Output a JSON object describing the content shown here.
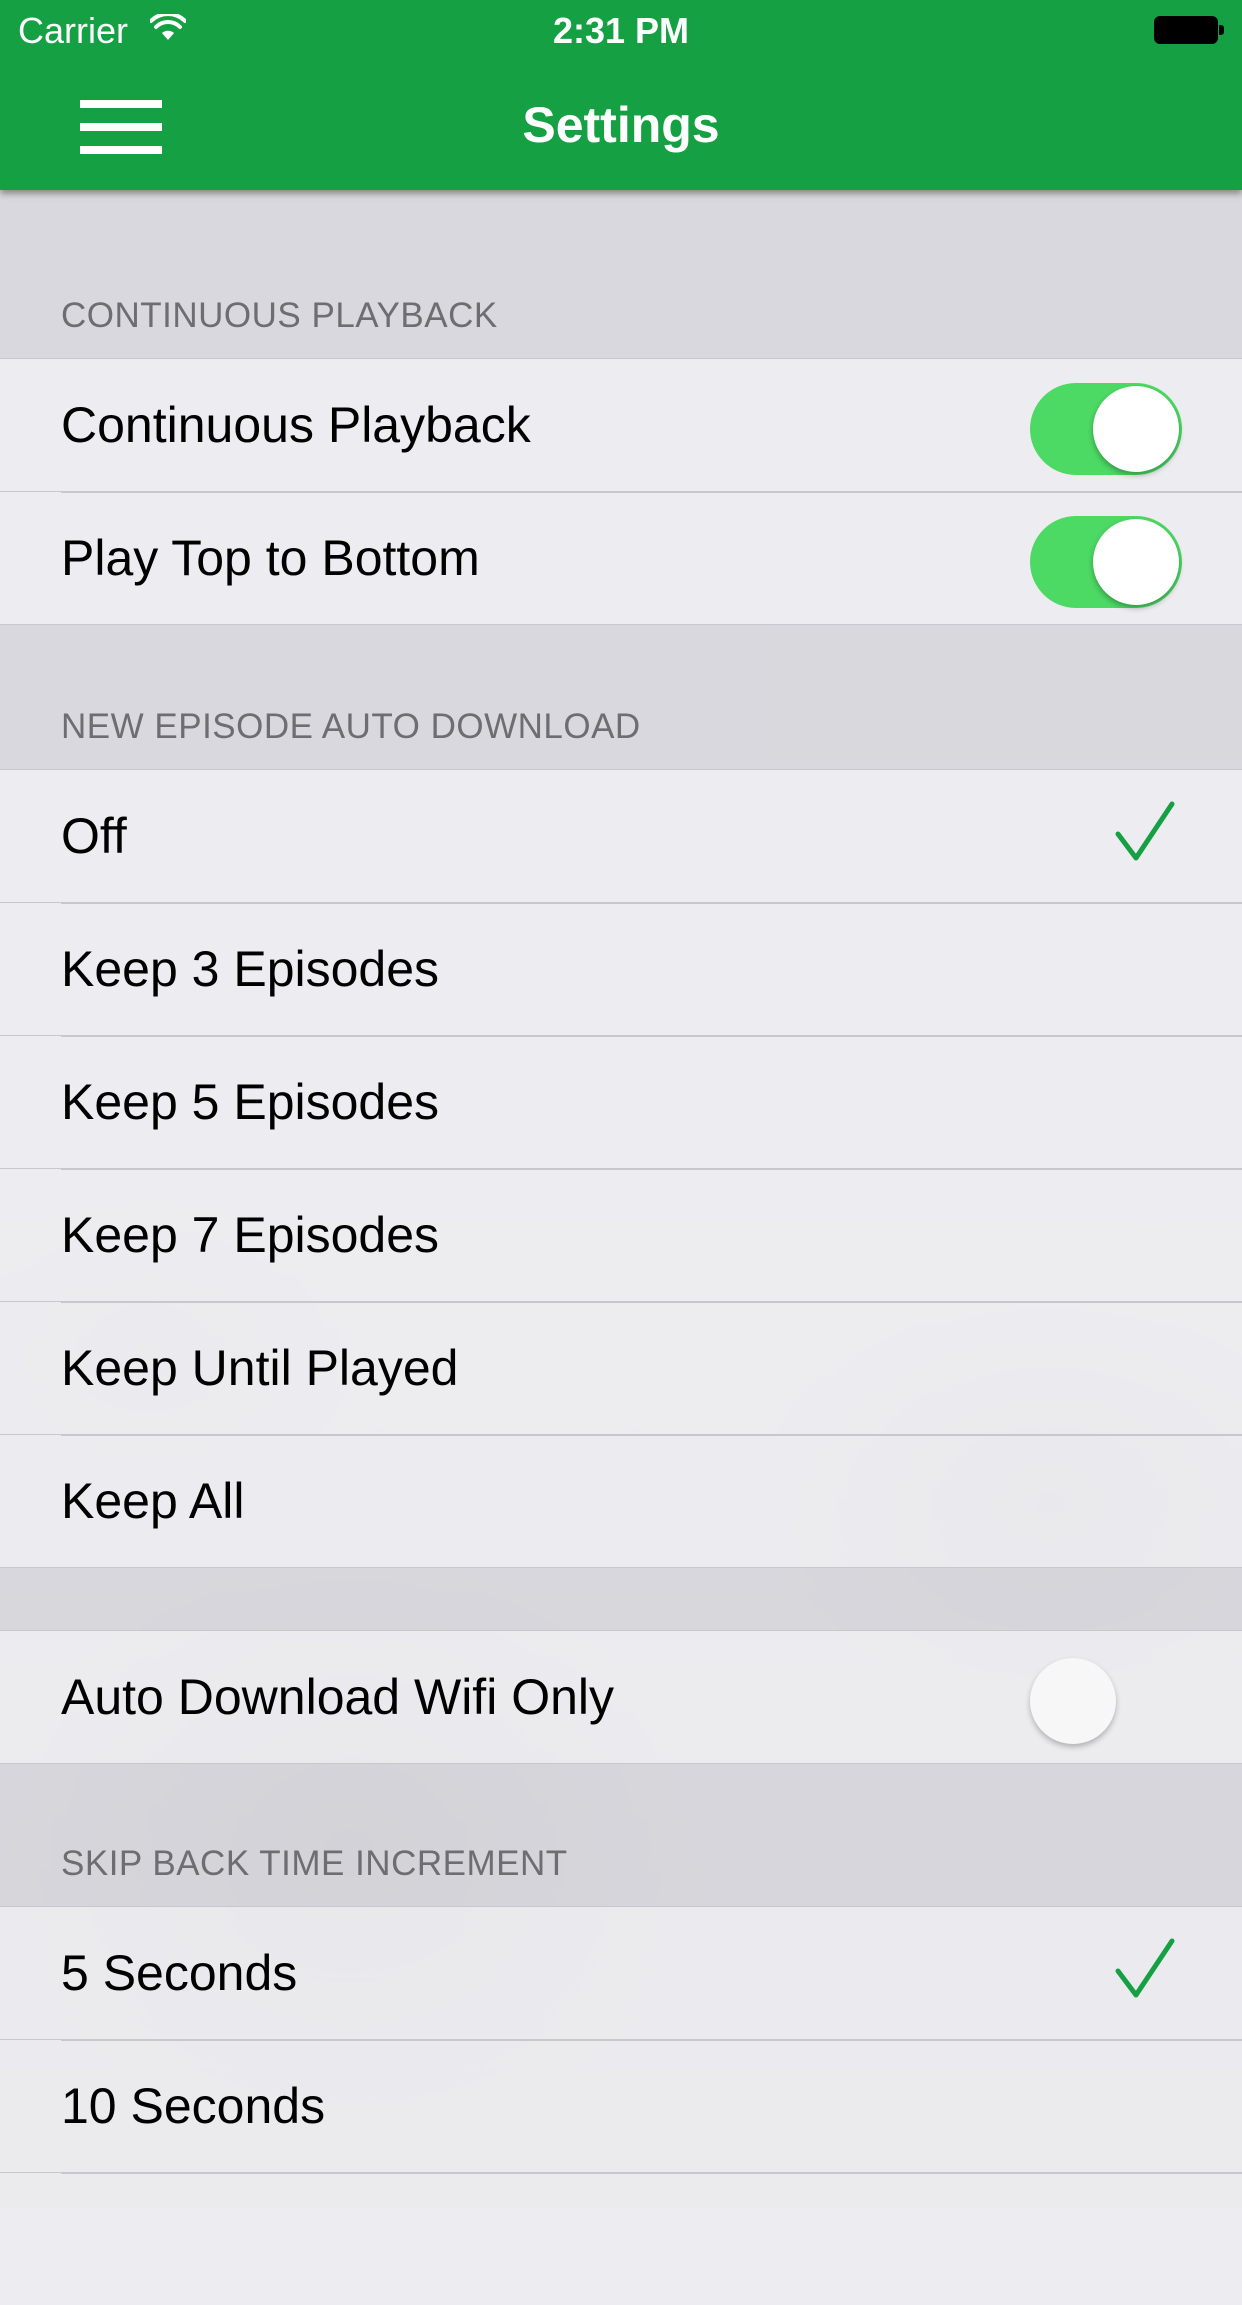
{
  "status_bar": {
    "carrier": "Carrier",
    "time": "2:31 PM"
  },
  "nav": {
    "title": "Settings",
    "menu_icon": "hamburger-menu-icon"
  },
  "colors": {
    "brand_green": "#16a044",
    "toggle_on": "#4cd964",
    "checkmark": "#16a044"
  },
  "sections": {
    "continuous": {
      "header": "CONTINUOUS PLAYBACK",
      "rows": [
        {
          "label": "Continuous Playback",
          "toggle": true
        },
        {
          "label": "Play Top to Bottom",
          "toggle": true
        }
      ]
    },
    "auto_download": {
      "header": "NEW EPISODE AUTO DOWNLOAD",
      "options": [
        "Off",
        "Keep 3 Episodes",
        "Keep 5 Episodes",
        "Keep 7 Episodes",
        "Keep Until Played",
        "Keep All"
      ],
      "selected": "Off"
    },
    "wifi": {
      "rows": [
        {
          "label": "Auto Download Wifi Only",
          "toggle": false
        }
      ]
    },
    "skip_back": {
      "header": "SKIP BACK TIME INCREMENT",
      "options": [
        "5 Seconds",
        "10 Seconds"
      ],
      "selected": "5 Seconds"
    }
  }
}
